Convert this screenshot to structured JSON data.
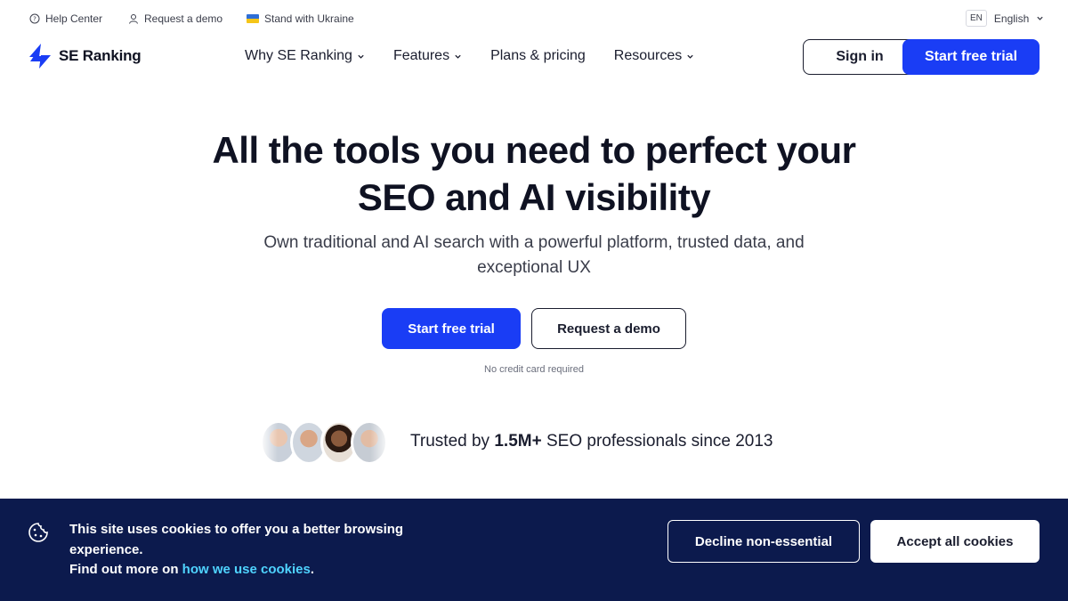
{
  "topbar": {
    "help_center": "Help Center",
    "request_demo": "Request a demo",
    "stand_with_ukraine": "Stand with Ukraine",
    "language_code": "EN",
    "language_label": "English"
  },
  "header": {
    "brand": "SE Ranking",
    "nav": [
      {
        "label": "Why SE Ranking",
        "has_dropdown": true
      },
      {
        "label": "Features",
        "has_dropdown": true
      },
      {
        "label": "Plans & pricing",
        "has_dropdown": false
      },
      {
        "label": "Resources",
        "has_dropdown": true
      }
    ],
    "sign_in": "Sign in",
    "start_trial": "Start free trial"
  },
  "hero": {
    "title_line1": "All the tools you need to perfect your",
    "title_line2": "SEO and AI visibility",
    "subtitle_line1": "Own traditional and AI search with a powerful platform, trusted data, and",
    "subtitle_line2": "exceptional UX",
    "primary_cta": "Start free trial",
    "secondary_cta": "Request a demo",
    "note": "No credit card required"
  },
  "trust": {
    "prefix": "Trusted by",
    "count": "1.5M+",
    "suffix": "SEO professionals since 2013"
  },
  "cookie_banner": {
    "text": "This site uses cookies to offer you a better browsing experience.",
    "find_more": "Find out more on",
    "link": "how we use cookies",
    "period": ".",
    "decline": "Decline non-essential",
    "accept": "Accept all cookies"
  },
  "colors": {
    "accent": "#1a3df5",
    "cookie_bg": "#0c1a4d",
    "cookie_link": "#4fd3ff",
    "text_dark": "#0f1222"
  },
  "icons": {
    "help": "question-circle-icon",
    "demo": "user-icon",
    "ukraine": "ukraine-flag-icon",
    "language": "chevron-down-icon",
    "logo": "se-ranking-logo-icon",
    "cookie": "cookie-icon"
  }
}
